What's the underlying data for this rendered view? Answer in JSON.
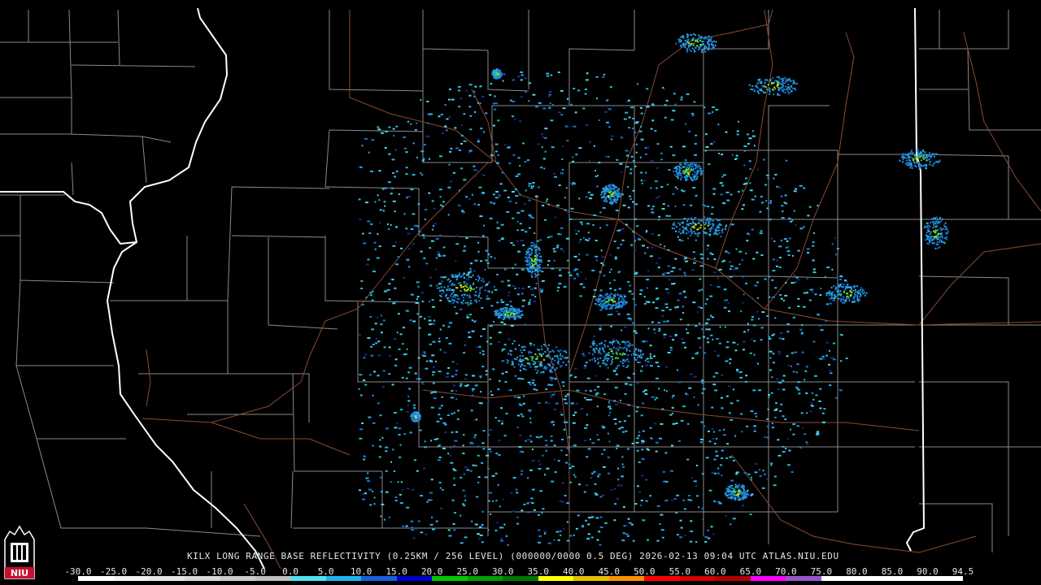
{
  "map": {
    "colors": {
      "background": "#000000",
      "county": "#8a8a8a",
      "state": "#ffffff",
      "highway": "#8b4a33"
    },
    "echo_palette": [
      "#1f2a8a",
      "#1877d2",
      "#27b8e6",
      "#49d7e8",
      "#2aa3e0",
      "#1fd36b",
      "#d8d800"
    ]
  },
  "logo": {
    "text": "NIU",
    "color": "#c8102e"
  },
  "caption": "KILX LONG RANGE BASE REFLECTIVITY (0.25KM / 256 LEVEL) (000000/0000 0.5 DEG) 2026-02-13 09:04 UTC  ATLAS.NIU.EDU",
  "scale": {
    "labels": [
      "-30.0",
      "-25.0",
      "-20.0",
      "-15.0",
      "-10.0",
      "-5.0",
      "0.0",
      "5.0",
      "10.0",
      "15.0",
      "20.0",
      "25.0",
      "30.0",
      "35.0",
      "40.0",
      "45.0",
      "50.0",
      "55.0",
      "60.0",
      "65.0",
      "70.0",
      "75.0",
      "80.0",
      "85.0",
      "90.0",
      "94.5"
    ],
    "colors": [
      "#ffffff",
      "#f2f2f2",
      "#e6e6e6",
      "#d9d9d9",
      "#cccccc",
      "#bfbfbf",
      "#4fe3f0",
      "#19b5f0",
      "#1a5fe0",
      "#0000cc",
      "#00c800",
      "#00a000",
      "#007800",
      "#ffff00",
      "#e6c000",
      "#ff9000",
      "#ff0000",
      "#d40000",
      "#b00000",
      "#ff00ff",
      "#9955cc",
      "#ffffff",
      "#ffffff",
      "#ffffff",
      "#ffffff"
    ]
  }
}
